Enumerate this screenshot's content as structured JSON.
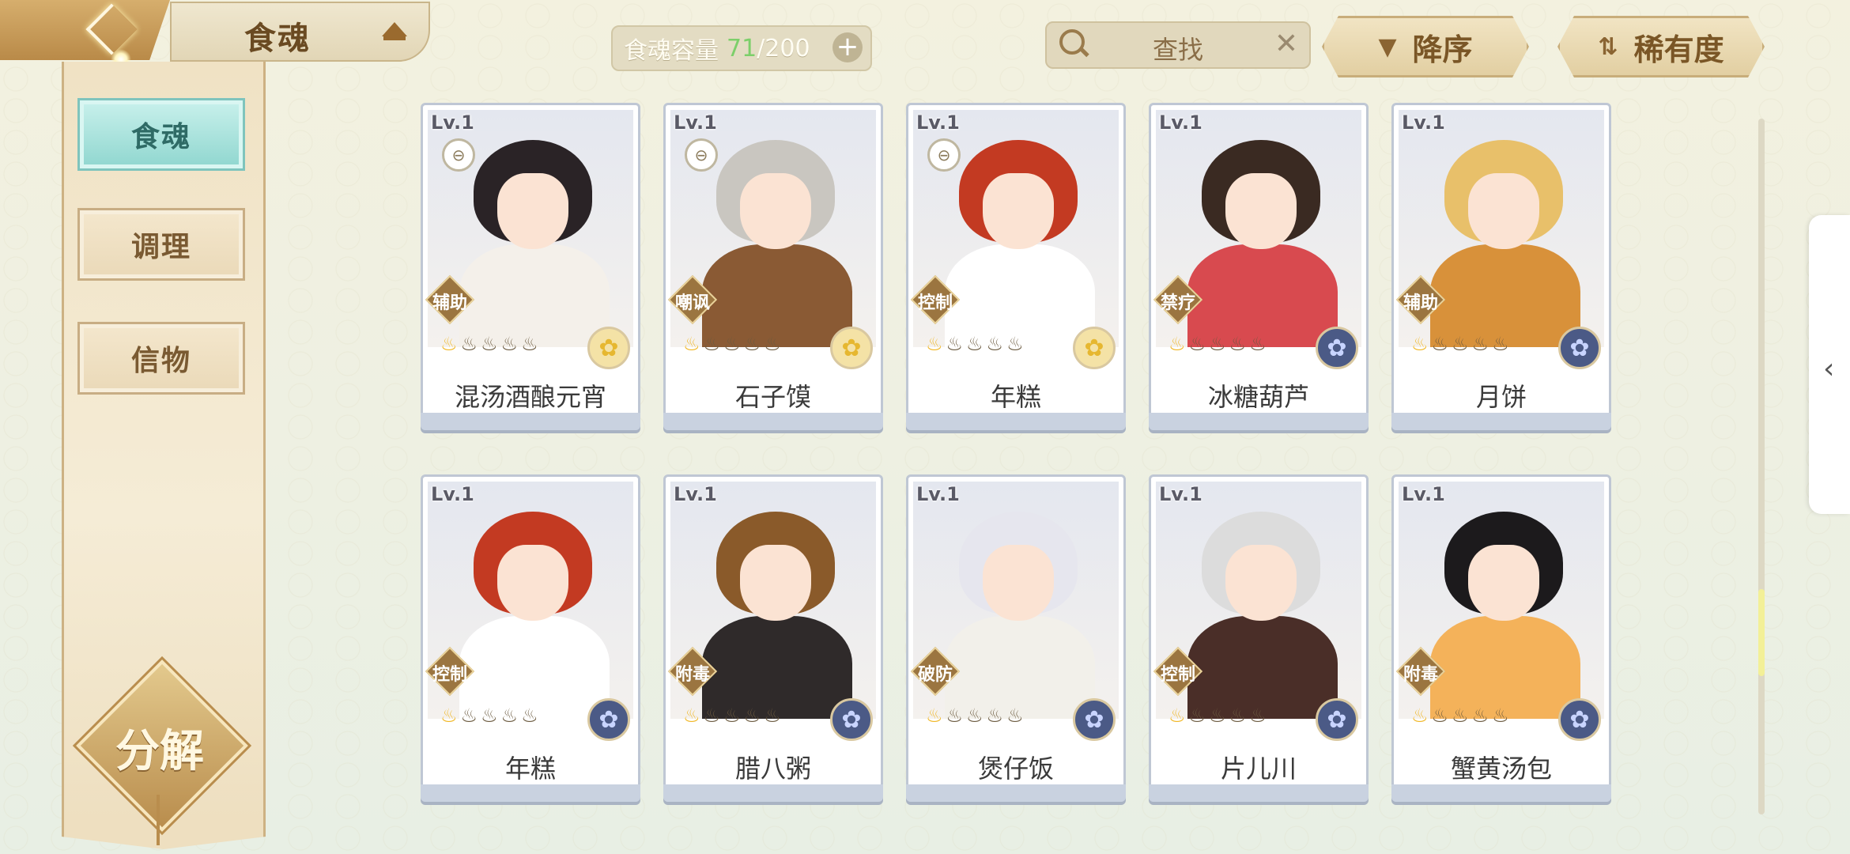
{
  "header": {
    "title": "食魂"
  },
  "sidebar": {
    "items": [
      {
        "label": "食魂",
        "active": true
      },
      {
        "label": "调理",
        "active": false
      },
      {
        "label": "信物",
        "active": false
      }
    ],
    "decompose_label": "分解"
  },
  "capacity": {
    "label": "食魂容量",
    "current": "71",
    "separator": "/",
    "max": "200",
    "plus_icon": "plus-icon"
  },
  "search": {
    "placeholder": "查找",
    "clear_icon": "close-icon"
  },
  "sort": {
    "order_label": "降序",
    "rarity_label": "稀有度"
  },
  "colors": {
    "accent_teal": "#8fd6cf",
    "capacity_current": "#7ccf6a",
    "gold": "#b98d4d"
  },
  "cards": [
    {
      "level": "Lv.1",
      "role": "辅助",
      "name": "混汤酒酿元宵",
      "medal": "gold",
      "badge": "⊖",
      "hair": "#2a2326",
      "body": "#f4f0ea"
    },
    {
      "level": "Lv.1",
      "role": "嘲讽",
      "name": "石子馍",
      "medal": "gold",
      "badge": "⊖",
      "hair": "#c9c6c0",
      "body": "#8a5a34"
    },
    {
      "level": "Lv.1",
      "role": "控制",
      "name": "年糕",
      "medal": "gold",
      "badge": "⊖",
      "hair": "#c33a22",
      "body": "#ffffff"
    },
    {
      "level": "Lv.1",
      "role": "禁疗",
      "name": "冰糖葫芦",
      "medal": "blue",
      "badge": "",
      "hair": "#3a2a22",
      "body": "#d84a4f"
    },
    {
      "level": "Lv.1",
      "role": "辅助",
      "name": "月饼",
      "medal": "blue",
      "badge": "",
      "hair": "#e8c06a",
      "body": "#d8913a"
    },
    {
      "level": "Lv.1",
      "role": "控制",
      "name": "年糕",
      "medal": "blue",
      "badge": "",
      "hair": "#c33a22",
      "body": "#ffffff"
    },
    {
      "level": "Lv.1",
      "role": "附毒",
      "name": "腊八粥",
      "medal": "blue",
      "badge": "",
      "hair": "#8a5a2a",
      "body": "#2f2a2a"
    },
    {
      "level": "Lv.1",
      "role": "破防",
      "name": "煲仔饭",
      "medal": "blue",
      "badge": "",
      "hair": "#e6e6ee",
      "body": "#f2f0ea"
    },
    {
      "level": "Lv.1",
      "role": "控制",
      "name": "片儿川",
      "medal": "blue",
      "badge": "",
      "hair": "#dcdcdc",
      "body": "#4a2e28"
    },
    {
      "level": "Lv.1",
      "role": "附毒",
      "name": "蟹黄汤包",
      "medal": "blue",
      "badge": "",
      "hair": "#1c1a1c",
      "body": "#f4b25a"
    }
  ]
}
